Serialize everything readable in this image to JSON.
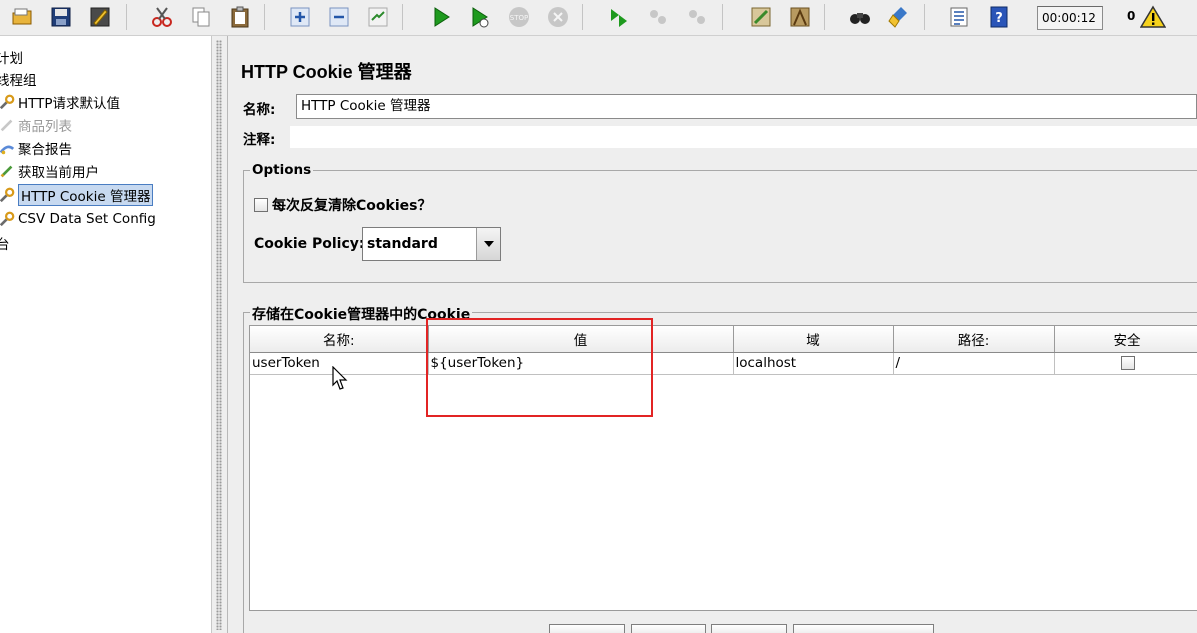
{
  "toolbar": {
    "timer": "00:00:12",
    "error_count": "0"
  },
  "tree": {
    "items": [
      {
        "label": "计划",
        "icon": "test-plan-icon"
      },
      {
        "label": "线程组",
        "icon": "thread-group-icon"
      },
      {
        "label": "HTTP请求默认值",
        "icon": "config-wrench-icon"
      },
      {
        "label": "商品列表",
        "icon": "sampler-pen-icon",
        "disabled": true
      },
      {
        "label": "聚合报告",
        "icon": "listener-chart-icon"
      },
      {
        "label": "获取当前用户",
        "icon": "sampler-pen-icon"
      },
      {
        "label": "HTTP Cookie 管理器",
        "icon": "config-wrench-icon",
        "selected": true
      },
      {
        "label": "CSV Data Set Config",
        "icon": "config-wrench-icon"
      },
      {
        "label": "台",
        "icon": "workbench-icon"
      }
    ]
  },
  "main": {
    "title": "HTTP Cookie 管理器",
    "name_label": "名称:",
    "name_value": "HTTP Cookie 管理器",
    "comment_label": "注释:",
    "comment_value": ""
  },
  "options": {
    "legend": "Options",
    "clear_each_iteration_label": "每次反复清除Cookies？",
    "clear_each_iteration_checked": false,
    "policy_label": "Cookie Policy:",
    "policy_value": "standard"
  },
  "cookies": {
    "legend": "存储在Cookie管理器中的Cookie",
    "columns": [
      "名称:",
      "值",
      "域",
      "路径:",
      "安全"
    ],
    "rows": [
      {
        "name": "userToken",
        "value": "${userToken}",
        "domain": "localhost",
        "path": "/",
        "secure": false
      }
    ]
  },
  "colors": {
    "highlight": "#e22424",
    "selection": "#c7d9f0"
  }
}
